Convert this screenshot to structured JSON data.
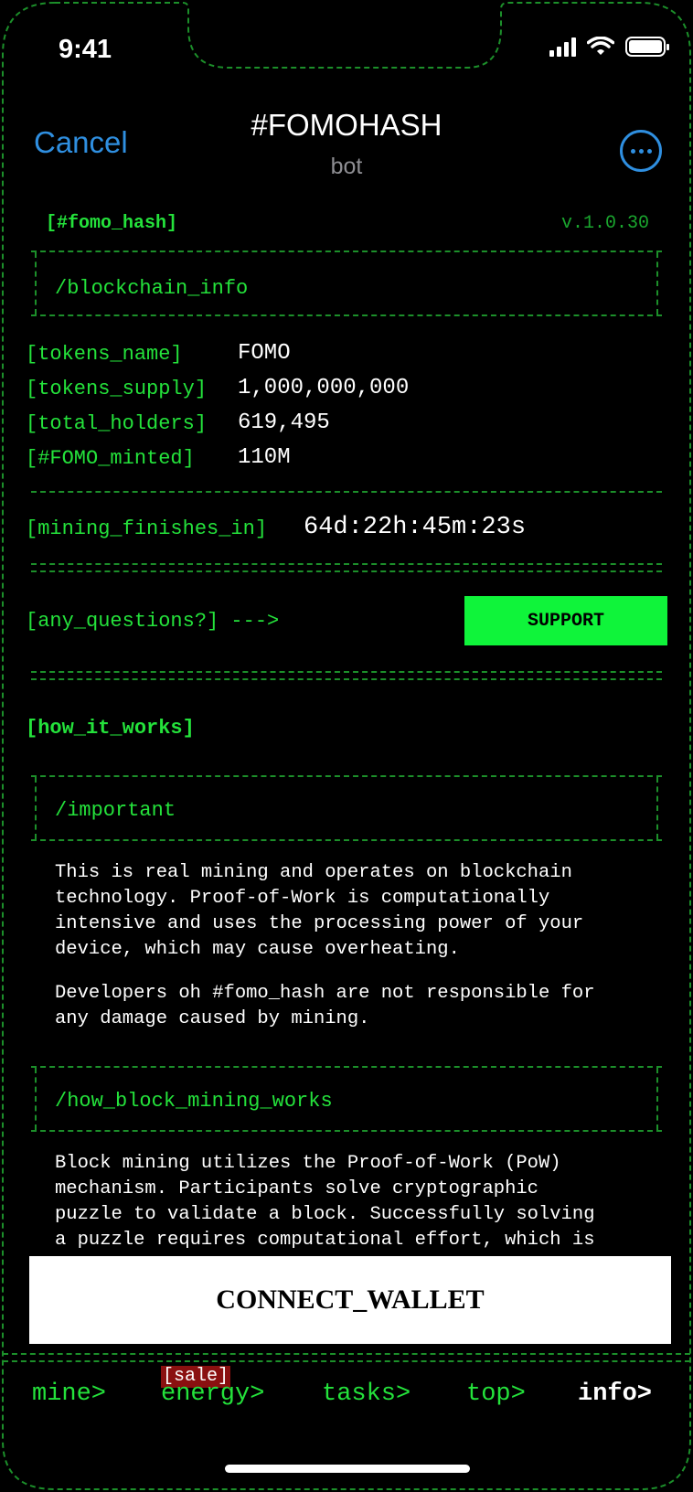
{
  "status": {
    "time": "9:41"
  },
  "header": {
    "cancel": "Cancel",
    "title": "#FOMOHASH",
    "subtitle": "bot"
  },
  "app": {
    "tag": "[#fomo_hash]",
    "version": "v.1.0.30"
  },
  "blockchain_info": {
    "heading": "/blockchain_info",
    "rows": [
      {
        "key": "[tokens_name]",
        "value": "FOMO"
      },
      {
        "key": "[tokens_supply]",
        "value": "1,000,000,000"
      },
      {
        "key": "[total_holders]",
        "value": "619,495"
      },
      {
        "key": "[#FOMO_minted]",
        "value": "110M"
      }
    ],
    "mining_key": "[mining_finishes_in]",
    "mining_value": "64d:22h:45m:23s"
  },
  "support": {
    "prompt": "[any_questions?] --->",
    "button": "SUPPORT"
  },
  "how": {
    "heading": "[how_it_works]",
    "important_heading": "/important",
    "important_p1": "This is real mining and operates on blockchain\ntechnology. Proof-of-Work is computationally\nintensive and uses the processing power of your\ndevice, which may cause overheating.",
    "important_p2": "Developers oh #fomo_hash are not responsible for\nany damage caused by mining.",
    "block_heading": "/how_block_mining_works",
    "block_p1": "Block mining utilizes the Proof-of-Work (PoW)\nmechanism. Participants solve cryptographic\npuzzle to validate a block. Successfully solving\na puzzle requires computational effort, which is"
  },
  "connect_button": "CONNECT_WALLET",
  "nav": {
    "mine": "mine>",
    "energy": "energy>",
    "energy_badge": "[sale]",
    "tasks": "tasks>",
    "top": "top>",
    "info": "info>"
  },
  "colors": {
    "green": "#24e23b",
    "bright_green": "#0ff43a",
    "link_blue": "#2f8fe0",
    "badge_red": "#8a1010"
  }
}
